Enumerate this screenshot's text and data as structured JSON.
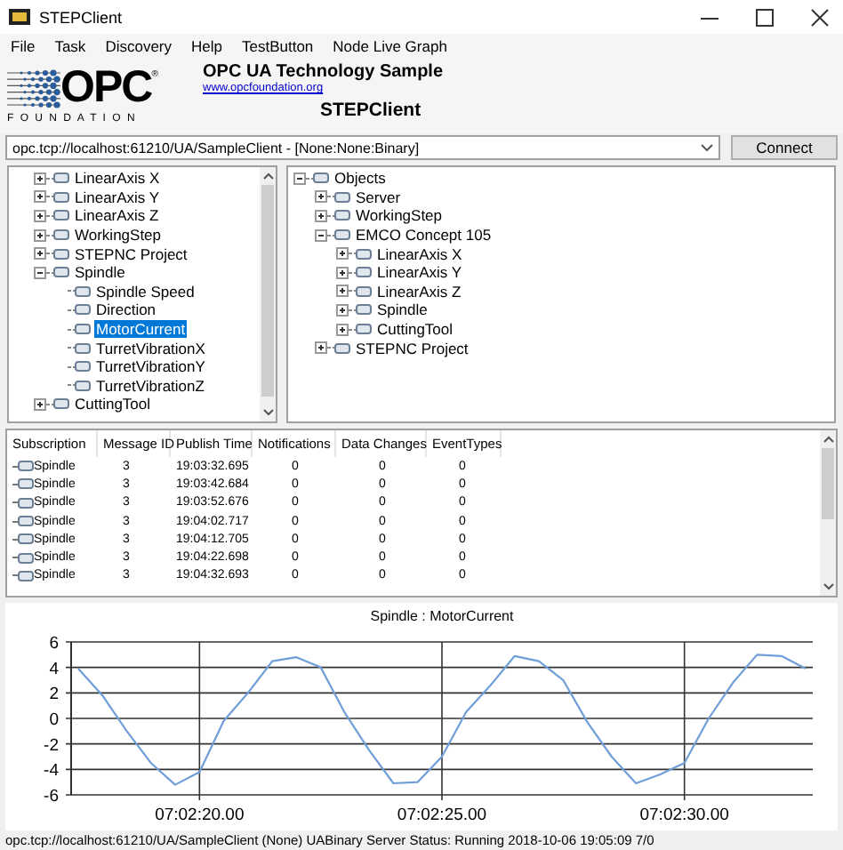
{
  "window": {
    "title": "STEPClient"
  },
  "menu": [
    {
      "label": "File"
    },
    {
      "label": "Task"
    },
    {
      "label": "Discovery"
    },
    {
      "label": "Help"
    },
    {
      "label": "TestButton"
    },
    {
      "label": "Node Live Graph"
    }
  ],
  "header": {
    "logo": {
      "mark": "OPC",
      "registered": "®",
      "tagline": "F O U N D A T I O N"
    },
    "title": "OPC UA Technology Sample",
    "link": "www.opcfoundation.org",
    "app_name": "STEPClient"
  },
  "endpoint": {
    "value": "opc.tcp://localhost:61210/UA/SampleClient - [None:None:Binary]",
    "button": "Connect"
  },
  "left_tree": [
    {
      "label": "LinearAxis X",
      "expanded": false,
      "selected": false
    },
    {
      "label": "LinearAxis Y",
      "expanded": false,
      "selected": false
    },
    {
      "label": "LinearAxis Z",
      "expanded": false,
      "selected": false
    },
    {
      "label": "WorkingStep",
      "expanded": false,
      "selected": false
    },
    {
      "label": "STEPNC Project",
      "expanded": false,
      "selected": false
    },
    {
      "label": "Spindle",
      "expanded": true,
      "selected": false,
      "children": [
        {
          "label": "Spindle Speed",
          "selected": false
        },
        {
          "label": "Direction",
          "selected": false
        },
        {
          "label": "MotorCurrent",
          "selected": true
        },
        {
          "label": "TurretVibrationX",
          "selected": false
        },
        {
          "label": "TurretVibrationY",
          "selected": false
        },
        {
          "label": "TurretVibrationZ",
          "selected": false
        }
      ]
    },
    {
      "label": "CuttingTool",
      "expanded": false,
      "selected": false
    }
  ],
  "right_tree": [
    {
      "label": "Objects",
      "expanded": true,
      "selected": false,
      "children": [
        {
          "label": "Server",
          "expanded": false,
          "selected": false
        },
        {
          "label": "WorkingStep",
          "expanded": false,
          "selected": false
        },
        {
          "label": "EMCO Concept 105",
          "expanded": true,
          "selected": false,
          "children": [
            {
              "label": "LinearAxis X",
              "expanded": false,
              "selected": false
            },
            {
              "label": "LinearAxis Y",
              "expanded": false,
              "selected": false
            },
            {
              "label": "LinearAxis Z",
              "expanded": false,
              "selected": false
            },
            {
              "label": "Spindle",
              "expanded": false,
              "selected": false
            },
            {
              "label": "CuttingTool",
              "expanded": false,
              "selected": false
            }
          ]
        },
        {
          "label": "STEPNC Project",
          "expanded": false,
          "selected": false
        }
      ]
    }
  ],
  "subscriptions": {
    "columns": [
      "Subscription",
      "Message ID",
      "Publish Time",
      "Notifications",
      "Data Changes",
      "EventTypes"
    ],
    "rows": [
      [
        "Spindle",
        "3",
        "19:03:32.695",
        "0",
        "0",
        "0"
      ],
      [
        "Spindle",
        "3",
        "19:03:42.684",
        "0",
        "0",
        "0"
      ],
      [
        "Spindle",
        "3",
        "19:03:52.676",
        "0",
        "0",
        "0"
      ],
      [
        "Spindle",
        "3",
        "19:04:02.717",
        "0",
        "0",
        "0"
      ],
      [
        "Spindle",
        "3",
        "19:04:12.705",
        "0",
        "0",
        "0"
      ],
      [
        "Spindle",
        "3",
        "19:04:22.698",
        "0",
        "0",
        "0"
      ],
      [
        "Spindle",
        "3",
        "19:04:32.693",
        "0",
        "0",
        "0"
      ]
    ]
  },
  "chart": {
    "chart_data": {
      "type": "line",
      "title": "Spindle : MotorCurrent",
      "categories": [
        null,
        null,
        null,
        null,
        null,
        "07:02:20.00",
        null,
        null,
        null,
        null,
        null,
        null,
        null,
        null,
        null,
        "07:02:25.00",
        null,
        null,
        null,
        null,
        null,
        null,
        null,
        null,
        null,
        "07:02:30.00",
        null,
        null,
        null,
        null,
        null
      ],
      "series": [
        {
          "color": "#6f9ed8",
          "values": [
            3.9,
            1.8,
            -1.0,
            -3.5,
            -5.2,
            -4.2,
            -0.2,
            2.0,
            4.5,
            4.8,
            4.0,
            0.4,
            -2.5,
            -5.1,
            -5.0,
            -3.0,
            0.5,
            2.6,
            4.9,
            4.5,
            3.0,
            -0.3,
            -3.0,
            -5.1,
            -4.4,
            -3.5,
            0.0,
            2.8,
            5.0,
            4.9,
            3.9
          ]
        }
      ],
      "grid": true,
      "ylim": [
        -6,
        6
      ],
      "yticks": [
        -6,
        -4,
        -2,
        0,
        2,
        4,
        6
      ]
    }
  },
  "status_bar": "opc.tcp://localhost:61210/UA/SampleClient (None) UABinary  Server Status: Running 2018-10-06 19:05:09 7/0"
}
